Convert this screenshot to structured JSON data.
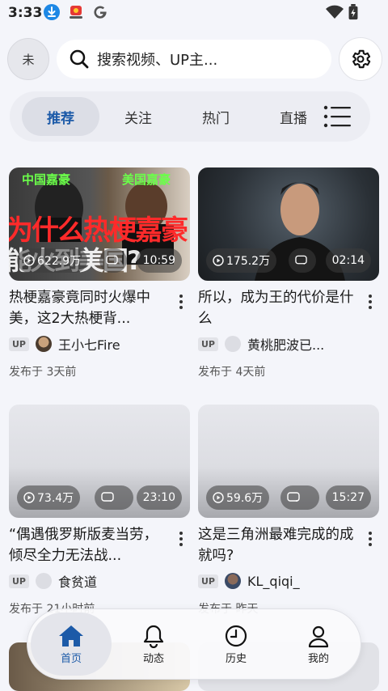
{
  "status_bar": {
    "time": "3:33",
    "icons": [
      "download-icon",
      "app-notification-icon",
      "google-icon",
      "wifi-icon",
      "battery-charging-icon"
    ]
  },
  "header": {
    "avatar_text": "未",
    "search_placeholder": "搜索视频、UP主...",
    "settings_icon": "gear-icon"
  },
  "tabs": [
    {
      "label": "推荐",
      "active": true
    },
    {
      "label": "关注",
      "active": false
    },
    {
      "label": "热门",
      "active": false
    },
    {
      "label": "直播",
      "active": false
    }
  ],
  "feed": [
    {
      "thumbnail_text_top_left": "中国嘉豪",
      "thumbnail_text_top_right": "美国嘉豪",
      "thumbnail_caption_line1": "为什么热梗嘉豪",
      "thumbnail_caption_line2": "能火到美国?",
      "views": "622.9万",
      "duration": "10:59",
      "title": "热梗嘉豪竟同时火爆中美，这2大热梗背...",
      "up_badge": "UP",
      "author": "王小七Fire",
      "published": "发布于 3天前"
    },
    {
      "views": "175.2万",
      "duration": "02:14",
      "title": "所以，成为王的代价是什么",
      "up_badge": "UP",
      "author": "黄桃肥波已...",
      "published": "发布于 4天前"
    },
    {
      "views": "73.4万",
      "duration": "23:10",
      "title": "“偶遇俄罗斯版麦当劳，倾尽全力无法战...",
      "up_badge": "UP",
      "author": "食贫道",
      "published": "发布于 21小时前"
    },
    {
      "views": "59.6万",
      "duration": "15:27",
      "title": "这是三角洲最难完成的成就吗?",
      "up_badge": "UP",
      "author": "KL_qiqi_",
      "published": "发布于 昨天"
    }
  ],
  "bottom_nav": [
    {
      "label": "首页",
      "icon": "home-icon",
      "active": true
    },
    {
      "label": "动态",
      "icon": "bell-icon",
      "active": false
    },
    {
      "label": "历史",
      "icon": "clock-icon",
      "active": false
    },
    {
      "label": "我的",
      "icon": "person-icon",
      "active": false
    }
  ],
  "colors": {
    "accent": "#1c5aa8",
    "background": "#f4f5fa"
  }
}
